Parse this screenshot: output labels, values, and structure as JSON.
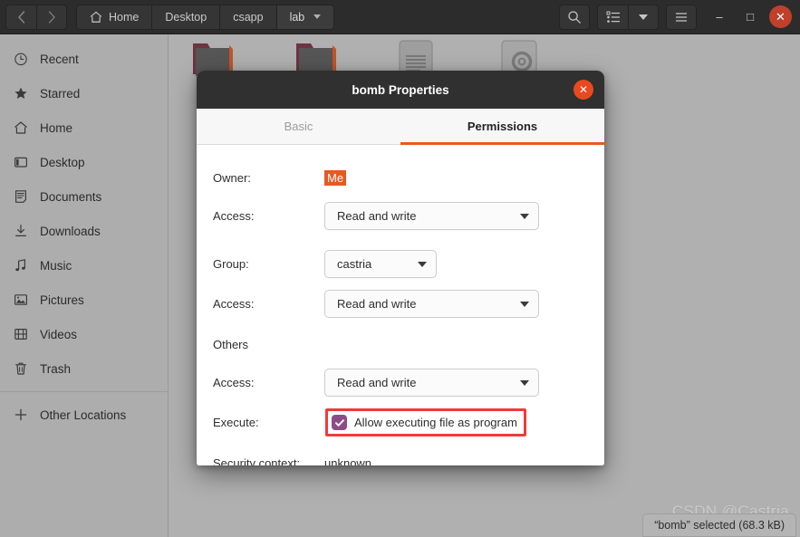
{
  "headerbar": {
    "back_icon": "chevron-left-icon",
    "forward_icon": "chevron-right-icon",
    "home_icon": "home-icon",
    "breadcrumbs": [
      {
        "label": "Home",
        "icon": "home-icon",
        "active": false
      },
      {
        "label": "Desktop",
        "icon": "",
        "active": false
      },
      {
        "label": "csapp",
        "icon": "",
        "active": false
      },
      {
        "label": "lab",
        "icon": "",
        "active": true
      }
    ],
    "search_icon": "search-icon",
    "view_list_icon": "list-view-icon",
    "view_dropdown_icon": "chevron-down-icon",
    "menu_icon": "hamburger-menu-icon",
    "minimize_label": "–",
    "maximize_label": "□",
    "close_label": "✕"
  },
  "sidebar": {
    "items": [
      {
        "label": "Recent",
        "icon": "clock-icon"
      },
      {
        "label": "Starred",
        "icon": "star-icon"
      },
      {
        "label": "Home",
        "icon": "home-icon"
      },
      {
        "label": "Desktop",
        "icon": "desktop-icon"
      },
      {
        "label": "Documents",
        "icon": "document-icon"
      },
      {
        "label": "Downloads",
        "icon": "download-icon"
      },
      {
        "label": "Music",
        "icon": "music-note-icon"
      },
      {
        "label": "Pictures",
        "icon": "picture-icon"
      },
      {
        "label": "Videos",
        "icon": "video-film-icon"
      },
      {
        "label": "Trash",
        "icon": "trash-icon"
      }
    ],
    "other_locations": {
      "label": "Other Locations",
      "icon": "plus-icon"
    }
  },
  "filearea": {
    "icons": [
      {
        "name": "folder-icon"
      },
      {
        "name": "folder-icon"
      },
      {
        "name": "text-file-icon"
      },
      {
        "name": "executable-file-icon"
      }
    ],
    "status_text": "“bomb” selected (68.3 kB)",
    "watermark": "CSDN @Castria"
  },
  "dialog": {
    "title": "bomb Properties",
    "close_icon": "close-icon",
    "close_label": "✕",
    "tabs": [
      {
        "label": "Basic",
        "active": false
      },
      {
        "label": "Permissions",
        "active": true
      }
    ],
    "owner": {
      "label": "Owner:",
      "value": "Me"
    },
    "owner_access": {
      "label": "Access:",
      "value": "Read and write"
    },
    "group": {
      "label": "Group:",
      "value": "castria"
    },
    "group_access": {
      "label": "Access:",
      "value": "Read and write"
    },
    "others": {
      "label": "Others"
    },
    "others_access": {
      "label": "Access:",
      "value": "Read and write"
    },
    "execute": {
      "label": "Execute:",
      "checkbox_label": "Allow executing file as program",
      "checked": true
    },
    "security_context": {
      "label": "Security context:",
      "value": "unknown"
    }
  },
  "colors": {
    "accent_orange": "#e8591f",
    "annotation_red": "#ef3b39",
    "checkbox_purple": "#8e4c87",
    "headerbar_dark": "#2c2c2c",
    "close_red": "#c0402b"
  }
}
